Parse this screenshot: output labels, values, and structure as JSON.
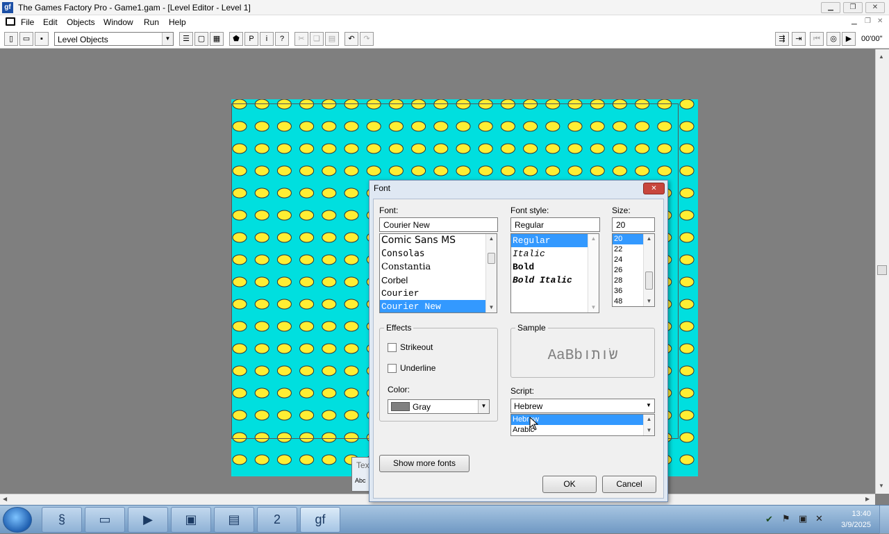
{
  "window": {
    "title": "The Games Factory Pro - Game1.gam - [Level Editor - Level 1]",
    "icon_text": "gf"
  },
  "menu": [
    "File",
    "Edit",
    "Objects",
    "Window",
    "Run",
    "Help"
  ],
  "toolbar": {
    "level_combo": "Level Objects",
    "time": "00'00\""
  },
  "level": {
    "background_color": "#00dfdf",
    "tile_color": "#ffee33",
    "object_label": "Tex",
    "object_sub": "Abc"
  },
  "dialog": {
    "title": "Font",
    "font_label": "Font:",
    "font_value": "Courier New",
    "fonts": [
      "Comic Sans MS",
      "Consolas",
      "Constantia",
      "Corbel",
      "Courier",
      "Courier New"
    ],
    "font_selected": 5,
    "style_label": "Font style:",
    "style_value": "Regular",
    "styles": [
      "Regular",
      "Italic",
      "Bold",
      "Bold Italic"
    ],
    "size_label": "Size:",
    "size_value": "20",
    "sizes": [
      "20",
      "22",
      "24",
      "26",
      "28",
      "36",
      "48"
    ],
    "effects_label": "Effects",
    "strikeout_label": "Strikeout",
    "underline_label": "Underline",
    "color_label": "Color:",
    "color_value": "Gray",
    "color_swatch": "#808080",
    "sample_label": "Sample",
    "sample_text": "AaBbשׂותו",
    "script_label": "Script:",
    "script_value": "Hebrew",
    "scripts": [
      "Hebrew",
      "Arabic"
    ],
    "show_more_label": "Show more fonts",
    "ok_label": "OK",
    "cancel_label": "Cancel"
  },
  "taskbar": {
    "clock_time": "13:40",
    "clock_date": "3/9/2025"
  }
}
